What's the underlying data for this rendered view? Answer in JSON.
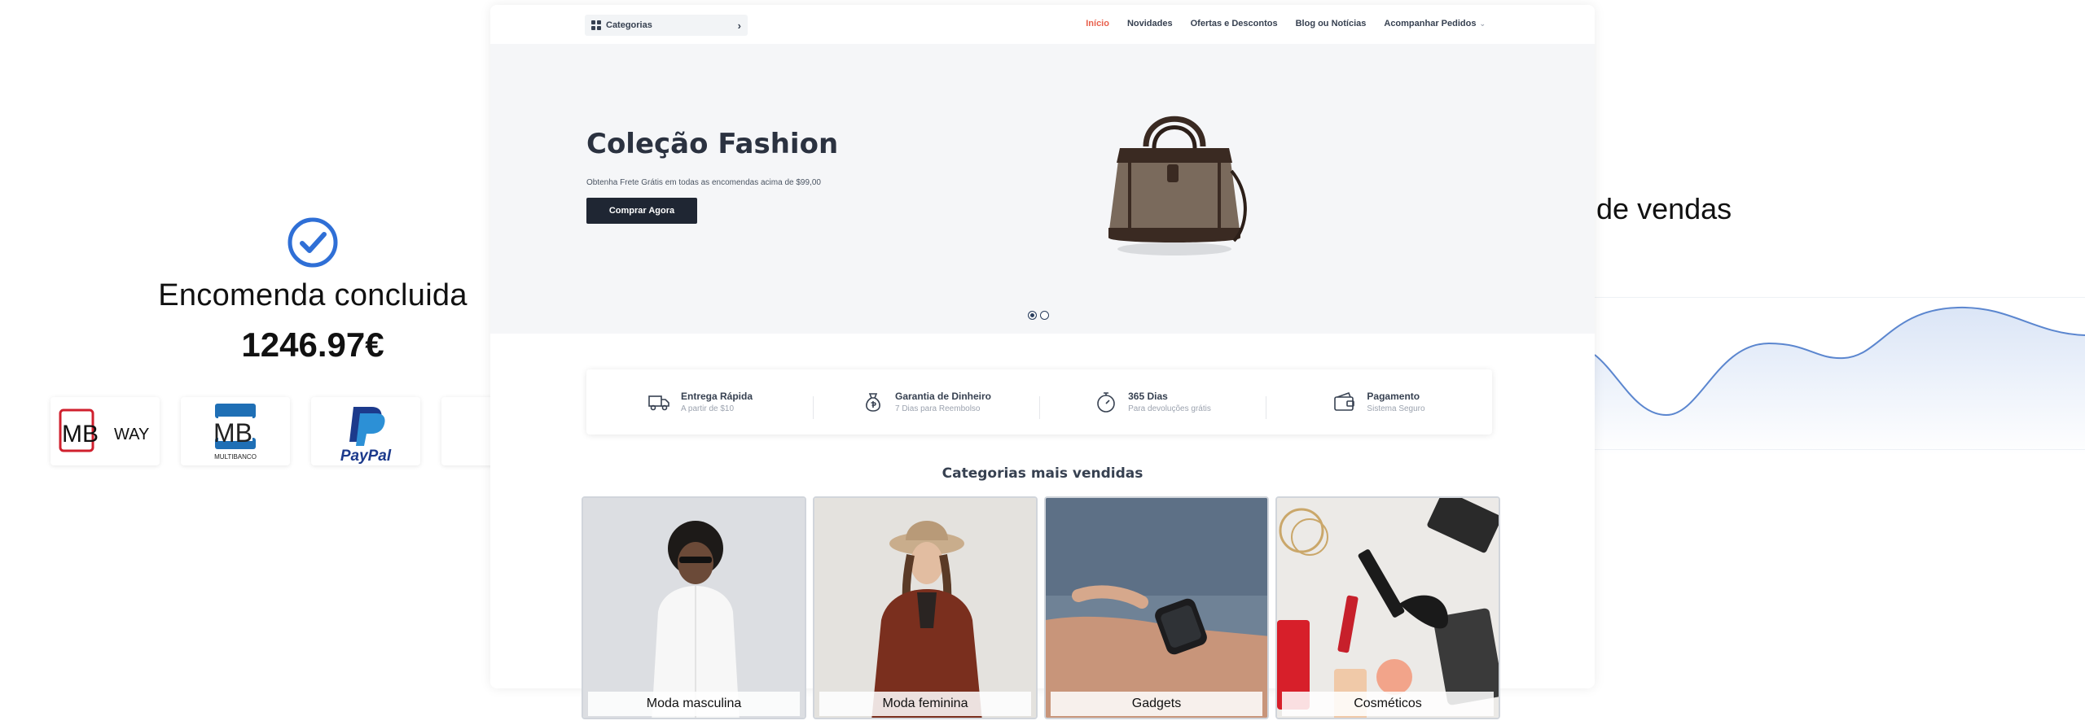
{
  "order": {
    "title": "Encomenda concluida",
    "amount": "1246.97€",
    "check_color": "#2f6fd6"
  },
  "payment_methods": [
    {
      "name": "MB WAY",
      "mb": "MB",
      "way": "WAY"
    },
    {
      "name": "Multibanco",
      "mb": "MB",
      "sub": "MULTIBANCO"
    },
    {
      "name": "PayPal",
      "text": "PayPal"
    }
  ],
  "sales_caption": "o de vendas",
  "site": {
    "nav": {
      "categories_label": "Categorias",
      "links": [
        "Início",
        "Novidades",
        "Ofertas e Descontos",
        "Blog ou Notícias",
        "Acompanhar Pedidos"
      ],
      "active_color": "#e8604c"
    },
    "hero": {
      "title": "Coleção Fashion",
      "subtitle": "Obtenha Frete Grátis em todas as encomendas acima de $99,00",
      "button": "Comprar Agora"
    },
    "features": [
      {
        "icon": "truck-icon",
        "title": "Entrega Rápida",
        "subtitle": "A partir de $10"
      },
      {
        "icon": "money-bag-icon",
        "title": "Garantia de Dinheiro",
        "subtitle": "7 Dias para Reembolso"
      },
      {
        "icon": "stopwatch-icon",
        "title": "365 Dias",
        "subtitle": "Para devoluções grátis"
      },
      {
        "icon": "wallet-icon",
        "title": "Pagamento",
        "subtitle": "Sistema Seguro"
      }
    ],
    "categories_heading": "Categorias mais vendidas",
    "categories": [
      {
        "label": "Moda masculina"
      },
      {
        "label": "Moda feminina"
      },
      {
        "label": "Gadgets"
      },
      {
        "label": "Cosméticos"
      }
    ]
  }
}
